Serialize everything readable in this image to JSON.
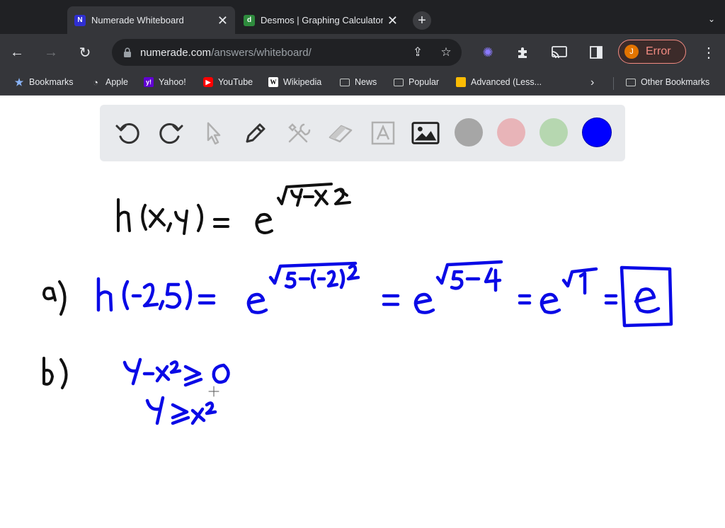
{
  "tabs": [
    {
      "title": "Numerade Whiteboard",
      "favicon": "numerade-icon",
      "active": true
    },
    {
      "title": "Desmos | Graphing Calculator",
      "favicon": "desmos-icon",
      "active": false
    }
  ],
  "address_bar": {
    "host": "numerade.com",
    "path": "/answers/whiteboard/"
  },
  "profile": {
    "initial": "J",
    "label": "Error"
  },
  "bookmarks": [
    {
      "label": "Bookmarks",
      "icon": "star-icon"
    },
    {
      "label": "Apple",
      "icon": "apple-icon"
    },
    {
      "label": "Yahoo!",
      "icon": "yahoo-icon"
    },
    {
      "label": "YouTube",
      "icon": "youtube-icon"
    },
    {
      "label": "Wikipedia",
      "icon": "wikipedia-icon"
    },
    {
      "label": "News",
      "icon": "folder-icon"
    },
    {
      "label": "Popular",
      "icon": "folder-icon"
    },
    {
      "label": "Advanced (Less...",
      "icon": "bookmark-page-icon"
    },
    {
      "label": "Other Bookmarks",
      "icon": "folder-icon"
    }
  ],
  "whiteboard": {
    "tools": [
      "undo",
      "redo",
      "select",
      "pen",
      "tools",
      "eraser",
      "text",
      "image"
    ],
    "colors": [
      "#a6a6a6",
      "#e8b4b8",
      "#b6d7b0",
      "#0000ff"
    ],
    "selected_color": "#0000ff",
    "ink": {
      "line1": "h(x,y) = e^√(y−x²)",
      "part_a_label": "a)",
      "part_a": "h(−2,5) = e^√(5−(−2)²) = e^√(5−4) = e^√1 = e",
      "part_a_answer": "e",
      "part_b_label": "b)",
      "part_b_line1": "y−x² ≥ 0",
      "part_b_line2": "y ≥ x²"
    }
  }
}
